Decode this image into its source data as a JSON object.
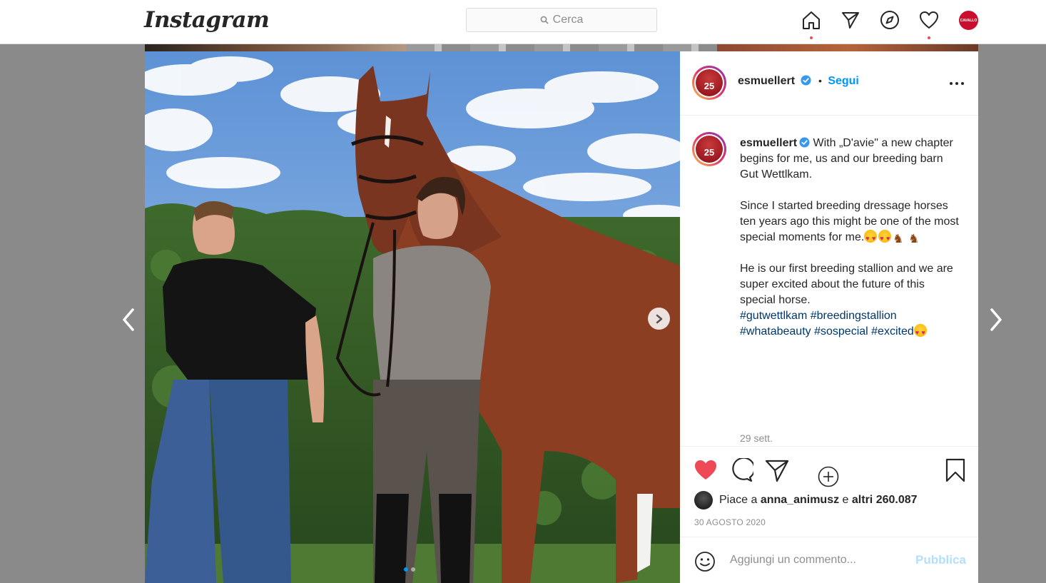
{
  "nav": {
    "logo": "Instagram",
    "search_placeholder": "Cerca",
    "icons": [
      "home-icon",
      "direct-icon",
      "explore-icon",
      "activity-heart-icon",
      "profile-avatar"
    ],
    "profile_avatar_text": "CAVALLO"
  },
  "post": {
    "username": "esmuellert",
    "verified": true,
    "separator": "•",
    "follow_label": "Segui",
    "caption_user": "esmuellert",
    "caption_p1": "With „D'avie\" a new chapter begins for me, us and our breeding barn Gut Wettlkam.",
    "caption_p2": "Since I started breeding dressage horses ten years ago this might be one of the most special moments for me.",
    "caption_p3": "He is our first breeding stallion and we are super excited about the future of this special horse.",
    "hashtags": [
      "#gutwettlkam",
      "#breedingstallion",
      "#whatabeauty",
      "#sospecial",
      "#excited"
    ],
    "caption_date": "29 sett.",
    "avatar_number": "25",
    "liked": true,
    "likes_prefix": "Piace a",
    "likes_user": "anna_animusz",
    "likes_conj": "e",
    "likes_count": "altri 260.087",
    "post_date": "30 AGOSTO 2020",
    "comment_placeholder": "Aggiungi un commento...",
    "publish_label": "Pubblica",
    "carousel_count": 2,
    "carousel_active": 1
  },
  "colors": {
    "accent": "#0095f6",
    "like_red": "#ed4956",
    "hashtag": "#00376b"
  }
}
